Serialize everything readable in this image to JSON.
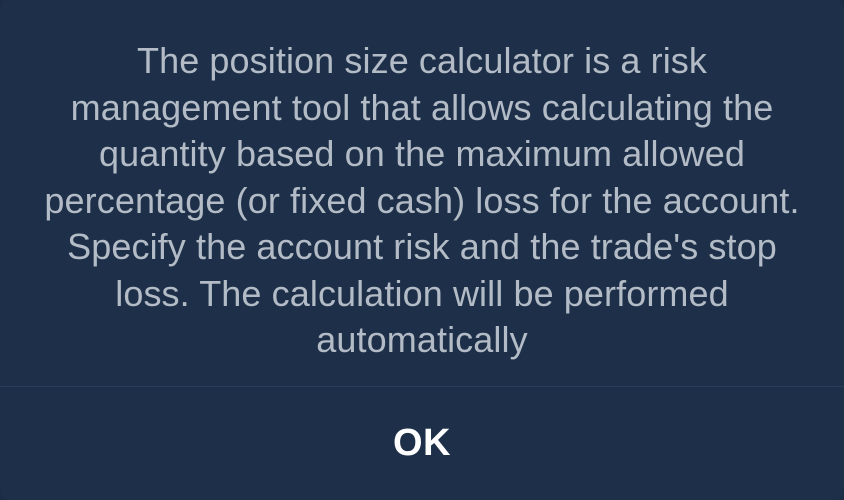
{
  "dialog": {
    "message": "The position size calculator is a risk management tool that allows calculating the quantity based on the maximum allowed percentage (or fixed cash) loss for the account. Specify the account risk and the trade's stop loss. The calculation will be performed automatically",
    "ok_label": "OK"
  },
  "colors": {
    "background": "#1e3049",
    "text": "#b3bcc6",
    "button_text": "#ffffff"
  }
}
